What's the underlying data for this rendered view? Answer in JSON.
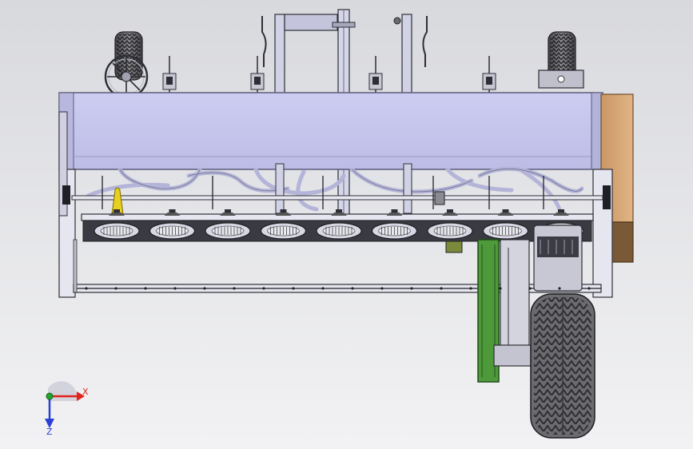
{
  "colors": {
    "background_top": "#d9dade",
    "background_bottom": "#f1f1f3",
    "hopper_fill": "#c7c7ef",
    "hopper_edge": "#6e6e8c",
    "frame_fill": "#d6d6ea",
    "frame_dark": "#2e2e36",
    "steel": "#b9b9c6",
    "chain_guard": "#4e9a3b",
    "chain_guard_dark": "#2d6a25",
    "panel_wood": "#d6a775",
    "panel_dark": "#7a5a36",
    "tire": "#6c6c70",
    "tire_dark": "#333336",
    "marker_yellow": "#e8d020",
    "axis_x": "#e0241c",
    "axis_y": "#22a52b",
    "axis_z": "#2a3fd6"
  },
  "icons": {
    "triad": "coordinate-triad-icon",
    "wheel": "tire-icon",
    "handwheel": "handwheel-icon"
  },
  "triad": {
    "x_label": "X",
    "z_label": "Z"
  },
  "seed_units": 9
}
